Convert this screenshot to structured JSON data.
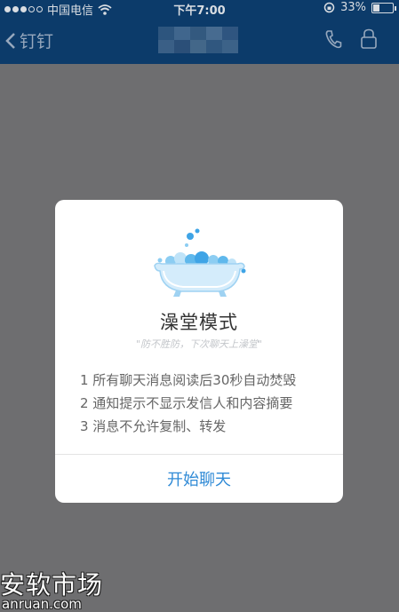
{
  "status_bar": {
    "carrier": "中国电信",
    "time": "下午7:00",
    "battery": "33%",
    "battery_level": 0.33
  },
  "nav": {
    "back_label": "钉钉",
    "icons": [
      "chevron-left-icon",
      "phone-icon",
      "lock-icon"
    ]
  },
  "dialog": {
    "title": "澡堂模式",
    "subtitle": "\"防不胜防，下次聊天上澡堂\"",
    "rules": [
      "1 所有聊天消息阅读后30秒自动焚毁",
      "2 通知提示不显示发信人和内容摘要",
      "3 消息不允许复制、转发"
    ],
    "action_label": "开始聊天",
    "icon": "bathtub-icon"
  },
  "watermark": {
    "name": "安软市场",
    "domain": "anruan.com"
  },
  "colors": {
    "nav_bg": "#0c3b6a",
    "overlay_bg": "#6e6e70",
    "accent": "#2f8ad6",
    "tub_blue": "#5fb8ec"
  }
}
